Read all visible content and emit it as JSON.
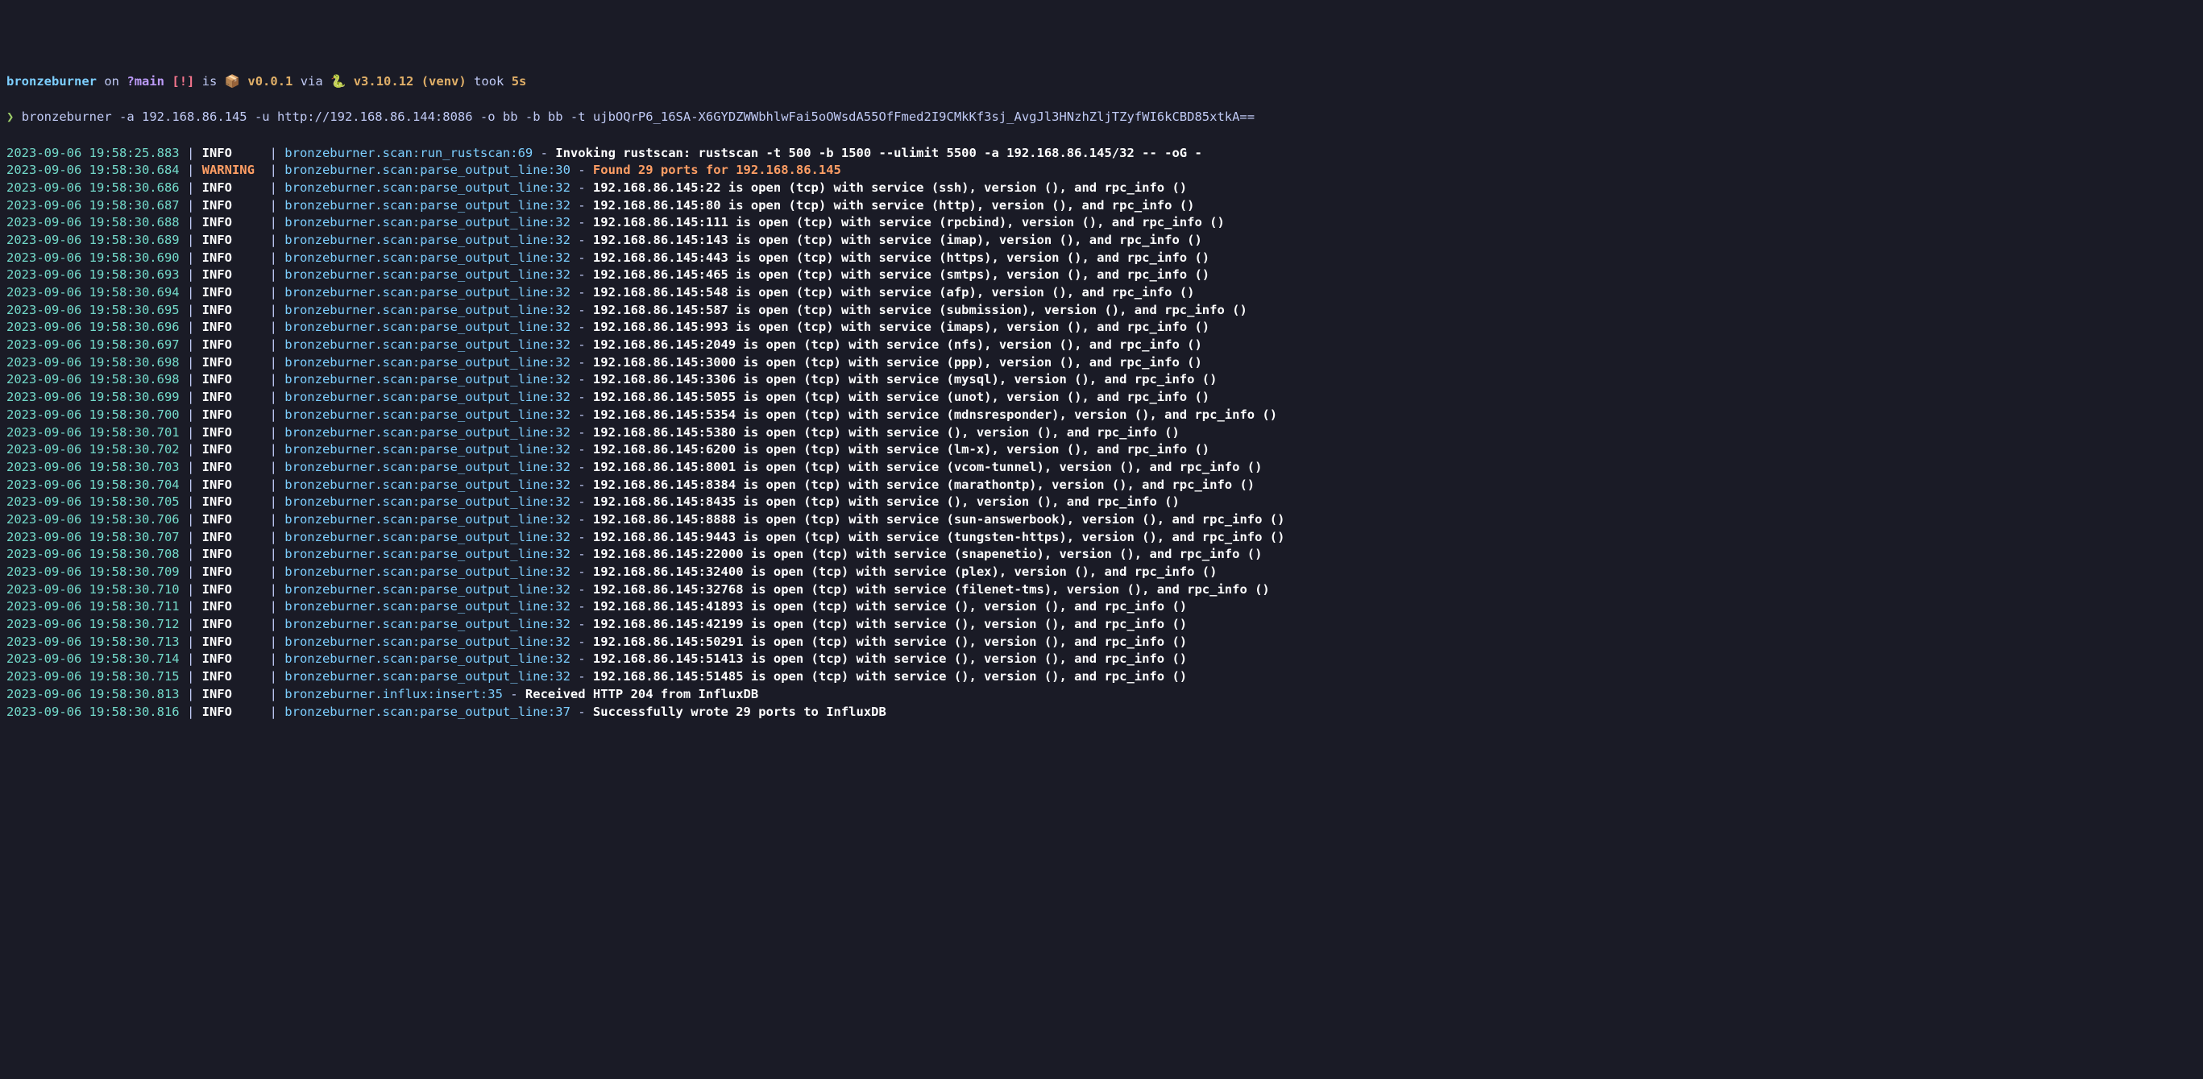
{
  "prompt": {
    "dir": "bronzeburner",
    "on_word": "on",
    "branch_prefix": "?",
    "branch_name": "main",
    "branch_flag": "[!]",
    "is_word": "is",
    "pkg_icon": "📦",
    "version": "v0.0.1",
    "via_word": "via",
    "snake_icon": "🐍",
    "py_version": "v3.10.12 (venv)",
    "took_word": "took",
    "took_time": "5s"
  },
  "cmd": {
    "arrow": "❯",
    "line": "bronzeburner -a 192.168.86.145 -u http://192.168.86.144:8086 -o bb -b bb -t ujbOQrP6_16SA-X6GYDZWWbhlwFai5oOWsdA55OfFmed2I9CMkKf3sj_AvgJl3HNzhZljTZyfWI6kCBD85xtkA=="
  },
  "logs": [
    {
      "ts": "2023-09-06 19:58:25.883",
      "lvl": "INFO",
      "src": "bronzeburner.scan:run_rustscan:69",
      "msgClass": "msg-white",
      "msg": "Invoking rustscan: rustscan -t 500 -b 1500 --ulimit 5500 -a 192.168.86.145/32 -- -oG -"
    },
    {
      "ts": "2023-09-06 19:58:30.684",
      "lvl": "WARNING",
      "src": "bronzeburner.scan:parse_output_line:30",
      "msgClass": "msg-orange",
      "msg": "Found 29 ports for 192.168.86.145"
    },
    {
      "ts": "2023-09-06 19:58:30.686",
      "lvl": "INFO",
      "src": "bronzeburner.scan:parse_output_line:32",
      "msgClass": "msg-white",
      "msg": "192.168.86.145:22 is open (tcp) with service (ssh), version (), and rpc_info ()"
    },
    {
      "ts": "2023-09-06 19:58:30.687",
      "lvl": "INFO",
      "src": "bronzeburner.scan:parse_output_line:32",
      "msgClass": "msg-white",
      "msg": "192.168.86.145:80 is open (tcp) with service (http), version (), and rpc_info ()"
    },
    {
      "ts": "2023-09-06 19:58:30.688",
      "lvl": "INFO",
      "src": "bronzeburner.scan:parse_output_line:32",
      "msgClass": "msg-white",
      "msg": "192.168.86.145:111 is open (tcp) with service (rpcbind), version (), and rpc_info ()"
    },
    {
      "ts": "2023-09-06 19:58:30.689",
      "lvl": "INFO",
      "src": "bronzeburner.scan:parse_output_line:32",
      "msgClass": "msg-white",
      "msg": "192.168.86.145:143 is open (tcp) with service (imap), version (), and rpc_info ()"
    },
    {
      "ts": "2023-09-06 19:58:30.690",
      "lvl": "INFO",
      "src": "bronzeburner.scan:parse_output_line:32",
      "msgClass": "msg-white",
      "msg": "192.168.86.145:443 is open (tcp) with service (https), version (), and rpc_info ()"
    },
    {
      "ts": "2023-09-06 19:58:30.693",
      "lvl": "INFO",
      "src": "bronzeburner.scan:parse_output_line:32",
      "msgClass": "msg-white",
      "msg": "192.168.86.145:465 is open (tcp) with service (smtps), version (), and rpc_info ()"
    },
    {
      "ts": "2023-09-06 19:58:30.694",
      "lvl": "INFO",
      "src": "bronzeburner.scan:parse_output_line:32",
      "msgClass": "msg-white",
      "msg": "192.168.86.145:548 is open (tcp) with service (afp), version (), and rpc_info ()"
    },
    {
      "ts": "2023-09-06 19:58:30.695",
      "lvl": "INFO",
      "src": "bronzeburner.scan:parse_output_line:32",
      "msgClass": "msg-white",
      "msg": "192.168.86.145:587 is open (tcp) with service (submission), version (), and rpc_info ()"
    },
    {
      "ts": "2023-09-06 19:58:30.696",
      "lvl": "INFO",
      "src": "bronzeburner.scan:parse_output_line:32",
      "msgClass": "msg-white",
      "msg": "192.168.86.145:993 is open (tcp) with service (imaps), version (), and rpc_info ()"
    },
    {
      "ts": "2023-09-06 19:58:30.697",
      "lvl": "INFO",
      "src": "bronzeburner.scan:parse_output_line:32",
      "msgClass": "msg-white",
      "msg": "192.168.86.145:2049 is open (tcp) with service (nfs), version (), and rpc_info ()"
    },
    {
      "ts": "2023-09-06 19:58:30.698",
      "lvl": "INFO",
      "src": "bronzeburner.scan:parse_output_line:32",
      "msgClass": "msg-white",
      "msg": "192.168.86.145:3000 is open (tcp) with service (ppp), version (), and rpc_info ()"
    },
    {
      "ts": "2023-09-06 19:58:30.698",
      "lvl": "INFO",
      "src": "bronzeburner.scan:parse_output_line:32",
      "msgClass": "msg-white",
      "msg": "192.168.86.145:3306 is open (tcp) with service (mysql), version (), and rpc_info ()"
    },
    {
      "ts": "2023-09-06 19:58:30.699",
      "lvl": "INFO",
      "src": "bronzeburner.scan:parse_output_line:32",
      "msgClass": "msg-white",
      "msg": "192.168.86.145:5055 is open (tcp) with service (unot), version (), and rpc_info ()"
    },
    {
      "ts": "2023-09-06 19:58:30.700",
      "lvl": "INFO",
      "src": "bronzeburner.scan:parse_output_line:32",
      "msgClass": "msg-white",
      "msg": "192.168.86.145:5354 is open (tcp) with service (mdnsresponder), version (), and rpc_info ()"
    },
    {
      "ts": "2023-09-06 19:58:30.701",
      "lvl": "INFO",
      "src": "bronzeburner.scan:parse_output_line:32",
      "msgClass": "msg-white",
      "msg": "192.168.86.145:5380 is open (tcp) with service (), version (), and rpc_info ()"
    },
    {
      "ts": "2023-09-06 19:58:30.702",
      "lvl": "INFO",
      "src": "bronzeburner.scan:parse_output_line:32",
      "msgClass": "msg-white",
      "msg": "192.168.86.145:6200 is open (tcp) with service (lm-x), version (), and rpc_info ()"
    },
    {
      "ts": "2023-09-06 19:58:30.703",
      "lvl": "INFO",
      "src": "bronzeburner.scan:parse_output_line:32",
      "msgClass": "msg-white",
      "msg": "192.168.86.145:8001 is open (tcp) with service (vcom-tunnel), version (), and rpc_info ()"
    },
    {
      "ts": "2023-09-06 19:58:30.704",
      "lvl": "INFO",
      "src": "bronzeburner.scan:parse_output_line:32",
      "msgClass": "msg-white",
      "msg": "192.168.86.145:8384 is open (tcp) with service (marathontp), version (), and rpc_info ()"
    },
    {
      "ts": "2023-09-06 19:58:30.705",
      "lvl": "INFO",
      "src": "bronzeburner.scan:parse_output_line:32",
      "msgClass": "msg-white",
      "msg": "192.168.86.145:8435 is open (tcp) with service (), version (), and rpc_info ()"
    },
    {
      "ts": "2023-09-06 19:58:30.706",
      "lvl": "INFO",
      "src": "bronzeburner.scan:parse_output_line:32",
      "msgClass": "msg-white",
      "msg": "192.168.86.145:8888 is open (tcp) with service (sun-answerbook), version (), and rpc_info ()"
    },
    {
      "ts": "2023-09-06 19:58:30.707",
      "lvl": "INFO",
      "src": "bronzeburner.scan:parse_output_line:32",
      "msgClass": "msg-white",
      "msg": "192.168.86.145:9443 is open (tcp) with service (tungsten-https), version (), and rpc_info ()"
    },
    {
      "ts": "2023-09-06 19:58:30.708",
      "lvl": "INFO",
      "src": "bronzeburner.scan:parse_output_line:32",
      "msgClass": "msg-white",
      "msg": "192.168.86.145:22000 is open (tcp) with service (snapenetio), version (), and rpc_info ()"
    },
    {
      "ts": "2023-09-06 19:58:30.709",
      "lvl": "INFO",
      "src": "bronzeburner.scan:parse_output_line:32",
      "msgClass": "msg-white",
      "msg": "192.168.86.145:32400 is open (tcp) with service (plex), version (), and rpc_info ()"
    },
    {
      "ts": "2023-09-06 19:58:30.710",
      "lvl": "INFO",
      "src": "bronzeburner.scan:parse_output_line:32",
      "msgClass": "msg-white",
      "msg": "192.168.86.145:32768 is open (tcp) with service (filenet-tms), version (), and rpc_info ()"
    },
    {
      "ts": "2023-09-06 19:58:30.711",
      "lvl": "INFO",
      "src": "bronzeburner.scan:parse_output_line:32",
      "msgClass": "msg-white",
      "msg": "192.168.86.145:41893 is open (tcp) with service (), version (), and rpc_info ()"
    },
    {
      "ts": "2023-09-06 19:58:30.712",
      "lvl": "INFO",
      "src": "bronzeburner.scan:parse_output_line:32",
      "msgClass": "msg-white",
      "msg": "192.168.86.145:42199 is open (tcp) with service (), version (), and rpc_info ()"
    },
    {
      "ts": "2023-09-06 19:58:30.713",
      "lvl": "INFO",
      "src": "bronzeburner.scan:parse_output_line:32",
      "msgClass": "msg-white",
      "msg": "192.168.86.145:50291 is open (tcp) with service (), version (), and rpc_info ()"
    },
    {
      "ts": "2023-09-06 19:58:30.714",
      "lvl": "INFO",
      "src": "bronzeburner.scan:parse_output_line:32",
      "msgClass": "msg-white",
      "msg": "192.168.86.145:51413 is open (tcp) with service (), version (), and rpc_info ()"
    },
    {
      "ts": "2023-09-06 19:58:30.715",
      "lvl": "INFO",
      "src": "bronzeburner.scan:parse_output_line:32",
      "msgClass": "msg-white",
      "msg": "192.168.86.145:51485 is open (tcp) with service (), version (), and rpc_info ()"
    },
    {
      "ts": "2023-09-06 19:58:30.813",
      "lvl": "INFO",
      "src": "bronzeburner.influx:insert:35",
      "msgClass": "msg-white",
      "msg": "Received HTTP 204 from InfluxDB"
    },
    {
      "ts": "2023-09-06 19:58:30.816",
      "lvl": "INFO",
      "src": "bronzeburner.scan:parse_output_line:37",
      "msgClass": "msg-white",
      "msg": "Successfully wrote 29 ports to InfluxDB"
    }
  ]
}
